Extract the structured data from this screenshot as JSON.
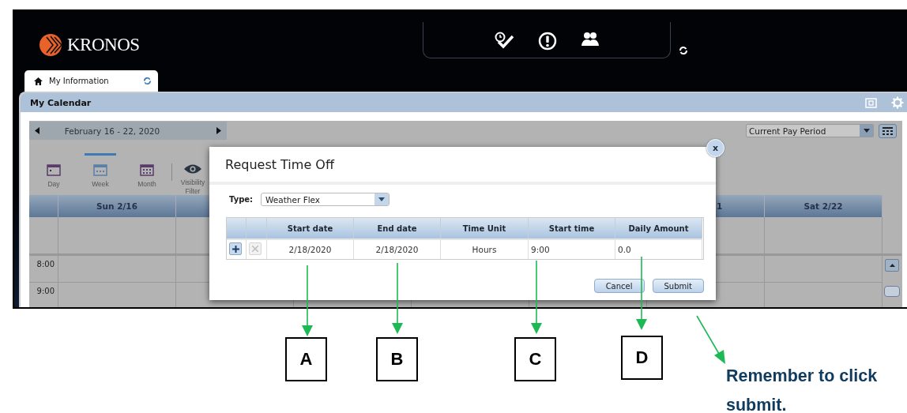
{
  "header": {
    "logo": "KRONOS"
  },
  "tabs": [
    {
      "label": "My Information",
      "selected": true
    }
  ],
  "panel": {
    "title": "My Calendar"
  },
  "toolbar": {
    "date_range": "February 16 - 22, 2020",
    "period": "Current Pay Period",
    "views": [
      {
        "label": "Day",
        "selected": false
      },
      {
        "label": "Week",
        "selected": true
      },
      {
        "label": "Month",
        "selected": false
      },
      {
        "label": "Visibility Filter",
        "selected": false
      }
    ]
  },
  "calendar": {
    "columns": [
      "Sun 2/16",
      "1",
      "Sat 2/22"
    ],
    "times": [
      "8:00",
      "9:00"
    ]
  },
  "dialog": {
    "title": "Request Time Off",
    "close": "x",
    "type_label": "Type:",
    "type_value": "Weather Flex",
    "columns": [
      "Start date",
      "End date",
      "Time Unit",
      "Start time",
      "Daily Amount"
    ],
    "row": {
      "values": [
        "2/18/2020",
        "2/18/2020",
        "Hours",
        "9:00",
        "0.0"
      ],
      "delete_disabled": true
    },
    "buttons": [
      "Cancel",
      "Submit"
    ]
  },
  "annotations": [
    "A",
    "B",
    "C",
    "D"
  ],
  "note": "Remember to click submit."
}
